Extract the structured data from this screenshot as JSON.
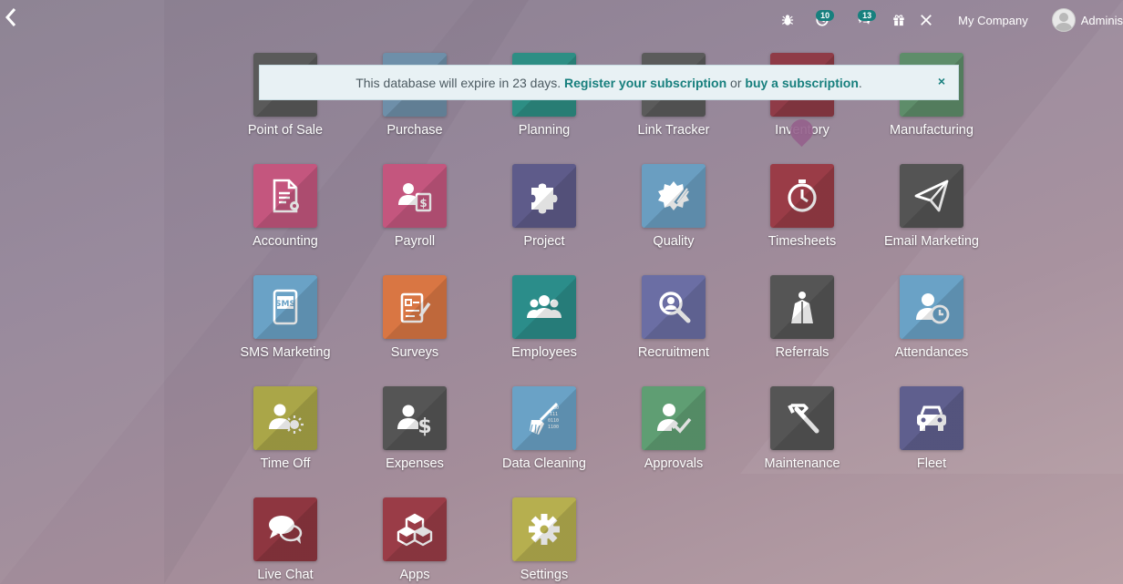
{
  "topbar": {
    "back_icon": "chevron-left-icon",
    "activity_badge": "10",
    "messages_badge": "13",
    "company": "My Company",
    "user": "Adminis"
  },
  "banner": {
    "text_before": "This database will expire in 23 days. ",
    "register_link": "Register your subscription",
    "text_middle": " or ",
    "buy_link": "buy a subscription",
    "text_after": ".",
    "close": "×"
  },
  "apps": [
    {
      "id": "point-of-sale",
      "label": "Point of Sale",
      "color": "#5a5a5a"
    },
    {
      "id": "purchase",
      "label": "Purchase",
      "color": "#6e8fa9"
    },
    {
      "id": "planning",
      "label": "Planning",
      "color": "#2d8e84"
    },
    {
      "id": "link-tracker",
      "label": "Link Tracker",
      "color": "#5b5b5b"
    },
    {
      "id": "inventory",
      "label": "Inventory",
      "color": "#8f3b47"
    },
    {
      "id": "manufacturing",
      "label": "Manufacturing",
      "color": "#5e8d6a"
    },
    {
      "id": "accounting",
      "label": "Accounting",
      "color": "#c4567e"
    },
    {
      "id": "payroll",
      "label": "Payroll",
      "color": "#c4567e"
    },
    {
      "id": "project",
      "label": "Project",
      "color": "#5e5b8a"
    },
    {
      "id": "quality",
      "label": "Quality",
      "color": "#6a9ec1"
    },
    {
      "id": "timesheets",
      "label": "Timesheets",
      "color": "#9a3c47"
    },
    {
      "id": "email-marketing",
      "label": "Email Marketing",
      "color": "#545454"
    },
    {
      "id": "sms-marketing",
      "label": "SMS Marketing",
      "color": "#6aa2c6"
    },
    {
      "id": "surveys",
      "label": "Surveys",
      "color": "#d97643"
    },
    {
      "id": "employees",
      "label": "Employees",
      "color": "#2b8d8a"
    },
    {
      "id": "recruitment",
      "label": "Recruitment",
      "color": "#6b6ea4"
    },
    {
      "id": "referrals",
      "label": "Referrals",
      "color": "#555555"
    },
    {
      "id": "attendances",
      "label": "Attendances",
      "color": "#6aa2c6"
    },
    {
      "id": "time-off",
      "label": "Time Off",
      "color": "#aaa648"
    },
    {
      "id": "expenses",
      "label": "Expenses",
      "color": "#555555"
    },
    {
      "id": "data-cleaning",
      "label": "Data Cleaning",
      "color": "#6aa2c6"
    },
    {
      "id": "approvals",
      "label": "Approvals",
      "color": "#5f9e73"
    },
    {
      "id": "maintenance",
      "label": "Maintenance",
      "color": "#555555"
    },
    {
      "id": "fleet",
      "label": "Fleet",
      "color": "#5f5f8e"
    },
    {
      "id": "live-chat",
      "label": "Live Chat",
      "color": "#8e3640"
    },
    {
      "id": "apps",
      "label": "Apps",
      "color": "#9a3c47"
    },
    {
      "id": "settings",
      "label": "Settings",
      "color": "#b6af4f"
    }
  ]
}
